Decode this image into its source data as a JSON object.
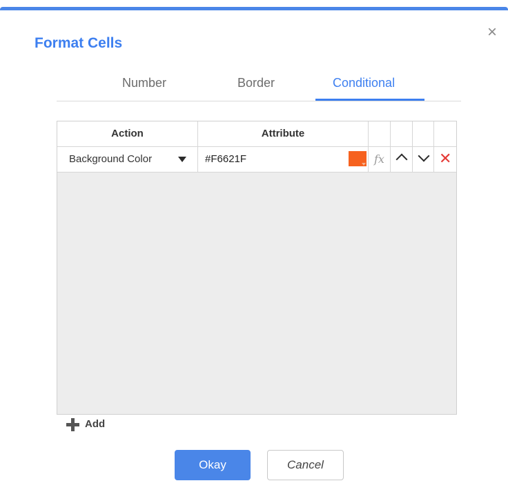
{
  "dialog": {
    "title": "Format Cells",
    "accent_color": "#4a86e8",
    "close_icon": "close-icon"
  },
  "tabs": [
    {
      "label": "Number",
      "active": false
    },
    {
      "label": "Border",
      "active": false
    },
    {
      "label": "Conditional",
      "active": true
    }
  ],
  "grid": {
    "columns": [
      "Action",
      "Attribute"
    ],
    "rows": [
      {
        "action": "Background Color",
        "attribute": "#F6621F",
        "swatch_color": "#F6621F",
        "icons": [
          "function-icon",
          "chevron-up-icon",
          "chevron-down-icon",
          "delete-icon"
        ]
      }
    ]
  },
  "footer": {
    "add_label": "Add",
    "okay_label": "Okay",
    "cancel_label": "Cancel"
  },
  "fx_label": "fx",
  "delete_glyph": "✕",
  "close_glyph": "×"
}
